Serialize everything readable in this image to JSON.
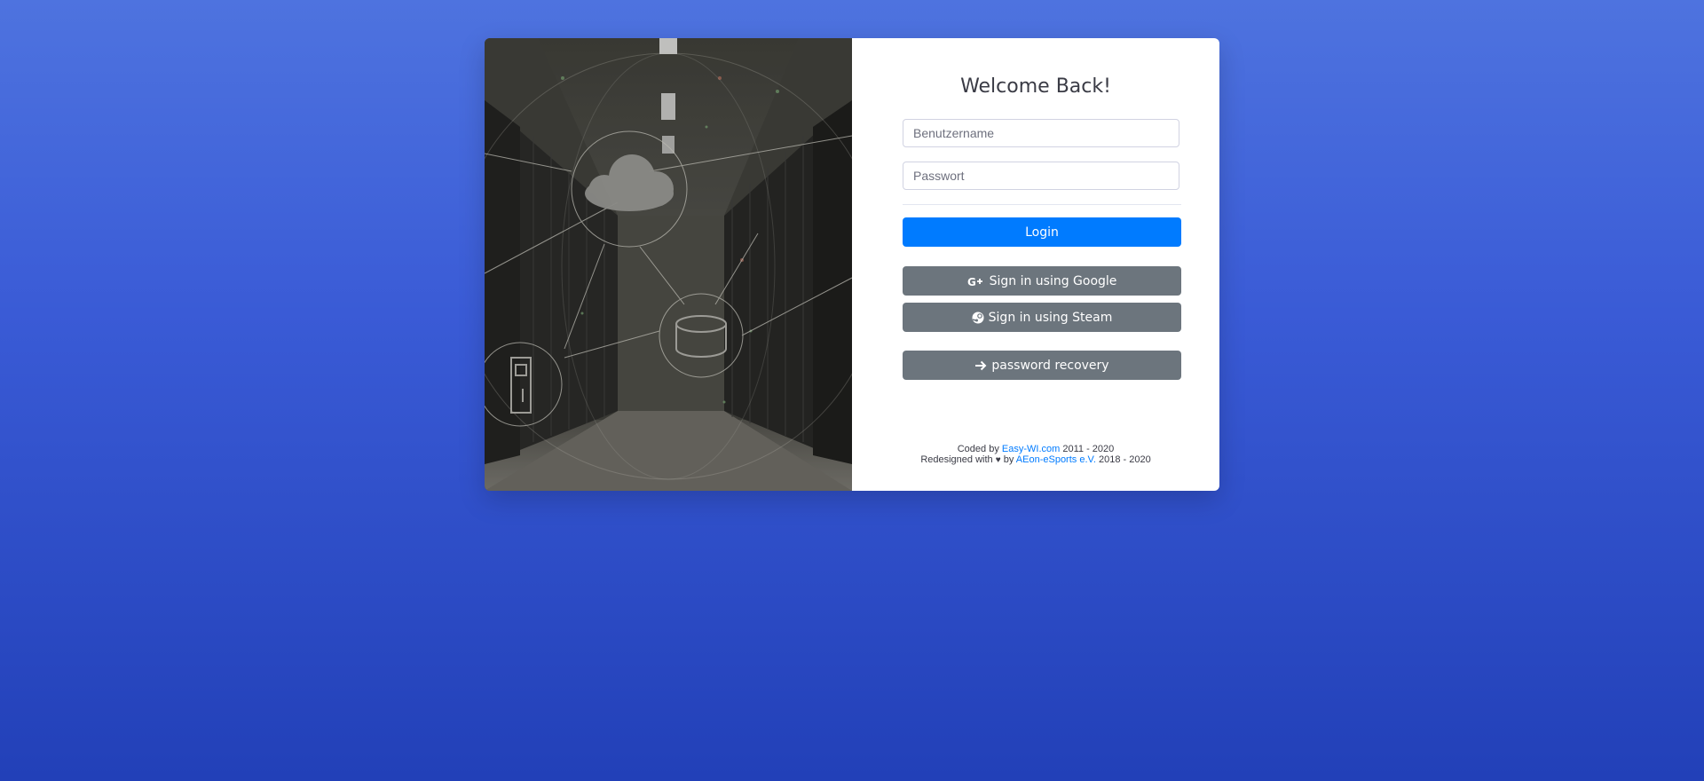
{
  "login": {
    "title": "Welcome Back!",
    "username_placeholder": "Benutzername",
    "password_placeholder": "Passwort",
    "login_label": "Login",
    "google_label": "Sign in using Google",
    "steam_label": "Sign in using Steam",
    "recovery_label": "password recovery"
  },
  "footer": {
    "line1_prefix": "Coded by",
    "line1_link": "Easy-WI.com",
    "line1_suffix": "2011 - 2020",
    "line2_prefix": "Redesigned with",
    "heart": "♥",
    "line2_by": "by",
    "line2_link": "AEon-eSports e.V.",
    "line2_suffix": "2018 - 2020"
  },
  "icons": {
    "google": "google-plus-icon",
    "steam": "steam-icon",
    "recovery": "arrow-right-icon"
  },
  "colors": {
    "primary": "#007bff",
    "secondary": "#6c757d",
    "background_top": "#4e73df",
    "background_bottom": "#2240b8"
  }
}
